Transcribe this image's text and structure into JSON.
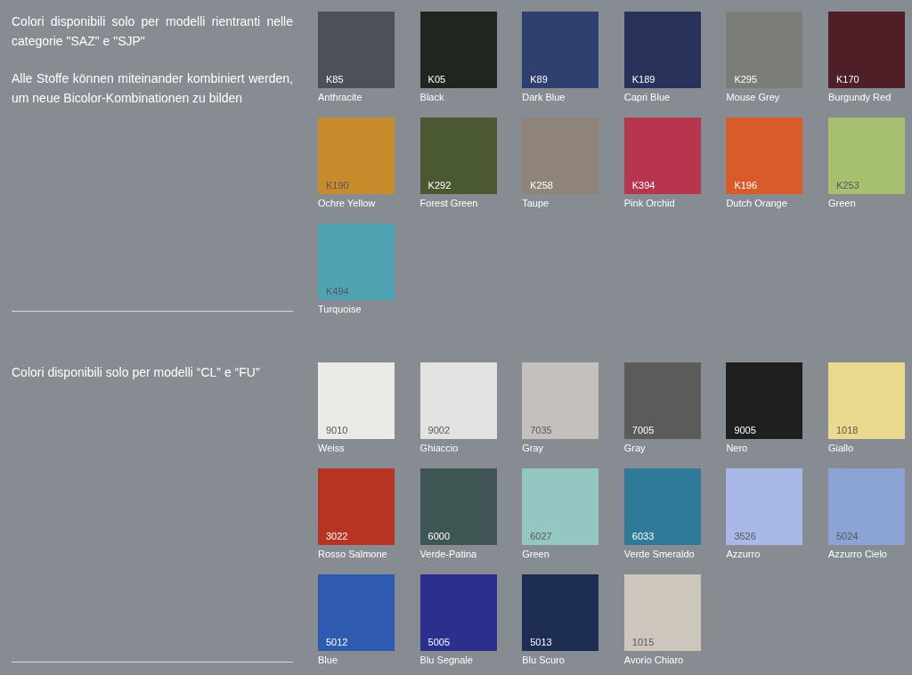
{
  "sections": [
    {
      "paragraphs": [
        "Colori disponibili solo per modelli rientranti nelle categorie \"SAZ\" e \"SJP\"",
        "Alle Stoffe können miteinander kombiniert werden, um neue Bicolor-Kombinationen zu bilden"
      ],
      "swatches": [
        {
          "code": "K85",
          "name": "Anthracite",
          "color": "#4c5157"
        },
        {
          "code": "K05",
          "name": "Black",
          "color": "#1f2620"
        },
        {
          "code": "K89",
          "name": "Dark Blue",
          "color": "#2f3f70"
        },
        {
          "code": "K189",
          "name": "Capri Blue",
          "color": "#28325a"
        },
        {
          "code": "K295",
          "name": "Mouse Grey",
          "color": "#7b7e78"
        },
        {
          "code": "K170",
          "name": "Burgundy Red",
          "color": "#4e1f26"
        },
        {
          "code": "K190",
          "name": "Ochre Yellow",
          "color": "#c88b2c"
        },
        {
          "code": "K292",
          "name": "Forest Green",
          "color": "#4a5932"
        },
        {
          "code": "K258",
          "name": "Taupe",
          "color": "#8f8479"
        },
        {
          "code": "K394",
          "name": "Pink Orchid",
          "color": "#b7354d"
        },
        {
          "code": "K196",
          "name": "Dutch Orange",
          "color": "#d85b29"
        },
        {
          "code": "K253",
          "name": "Green",
          "color": "#a7c06f"
        },
        {
          "code": "K494",
          "name": "Turquoise",
          "color": "#4fa3b3"
        }
      ]
    },
    {
      "paragraphs": [
        "Colori disponibili solo per modelli “CL” e “FU”"
      ],
      "swatches": [
        {
          "code": "9010",
          "name": "Weiss",
          "color": "#ebeae6"
        },
        {
          "code": "9002",
          "name": "Ghiaccio",
          "color": "#e3e3e1"
        },
        {
          "code": "7035",
          "name": "Gray",
          "color": "#c4c1bc"
        },
        {
          "code": "7005",
          "name": "Gray",
          "color": "#5b5c59"
        },
        {
          "code": "9005",
          "name": "Nero",
          "color": "#1f1f21"
        },
        {
          "code": "1018",
          "name": "Giallo",
          "color": "#ebd98f"
        },
        {
          "code": "3022",
          "name": "Rosso Salmone",
          "color": "#b73423"
        },
        {
          "code": "6000",
          "name": "Verde-Patina",
          "color": "#3f5554"
        },
        {
          "code": "6027",
          "name": "Green",
          "color": "#95c6c2"
        },
        {
          "code": "6033",
          "name": "Verde Smeraldo",
          "color": "#2f7a98"
        },
        {
          "code": "3526",
          "name": "Azzurro",
          "color": "#a9b8e7"
        },
        {
          "code": "5024",
          "name": "Azzurro Cielo",
          "color": "#8ba4d5"
        },
        {
          "code": "5012",
          "name": "Blue",
          "color": "#2e5baf"
        },
        {
          "code": "5005",
          "name": "Blu Segnale",
          "color": "#2b2f8e"
        },
        {
          "code": "5013",
          "name": "Blu Scuro",
          "color": "#1e2e52"
        },
        {
          "code": "1015",
          "name": "Avorio Chiaro",
          "color": "#cdc6bd"
        }
      ]
    }
  ]
}
